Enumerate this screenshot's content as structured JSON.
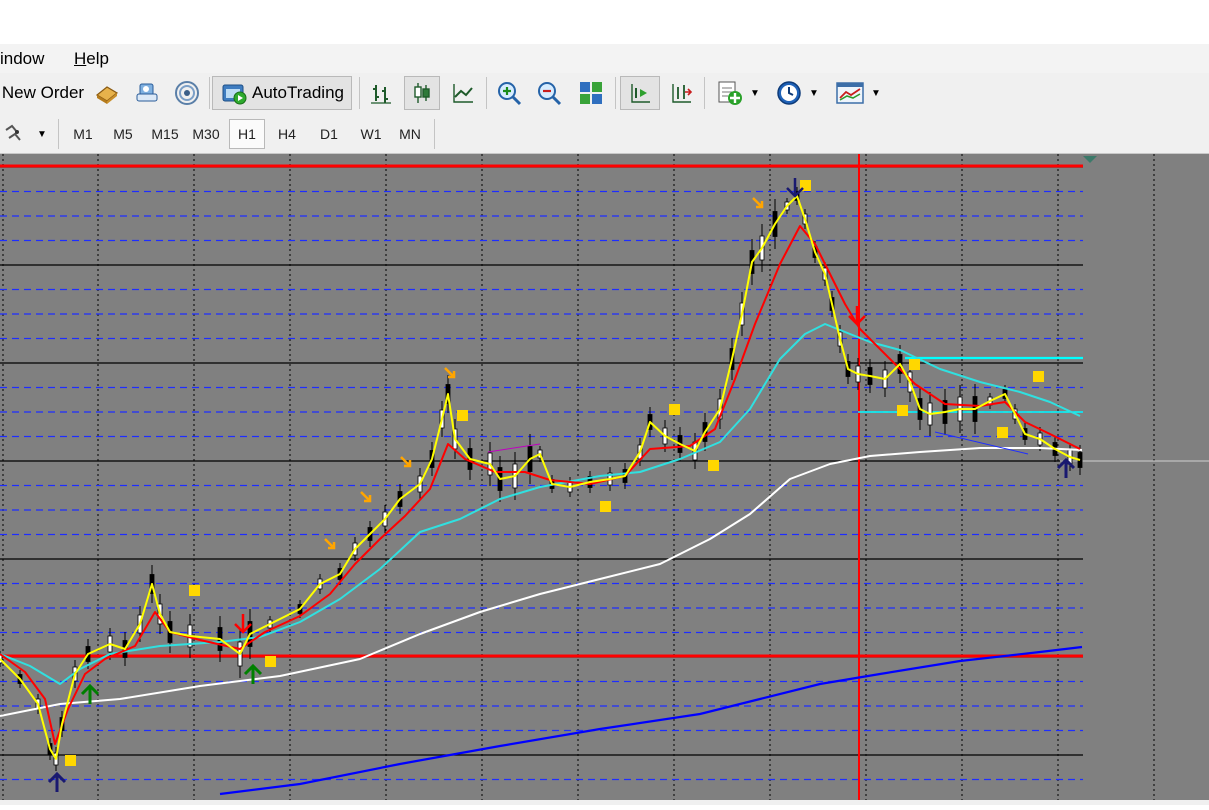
{
  "menu": {
    "window_label": "indow",
    "help_label": "Help"
  },
  "toolbar": {
    "new_order_label": "New Order",
    "autotrading_label": "AutoTrading",
    "icons": [
      "market-watch-icon",
      "data-window-icon",
      "signals-icon",
      "autotrading-icon",
      "bar-chart-icon",
      "candlestick-icon",
      "line-chart-icon",
      "zoom-in-icon",
      "zoom-out-icon",
      "tile-windows-icon",
      "chart-shift-icon",
      "autoscroll-icon",
      "indicators-icon",
      "periodicity-icon",
      "templates-icon"
    ]
  },
  "timeframes": {
    "items": [
      "M1",
      "M5",
      "M15",
      "M30",
      "H1",
      "H4",
      "D1",
      "W1",
      "MN"
    ],
    "active": "H1"
  },
  "chart_data": {
    "type": "line",
    "background": "#808080",
    "foreground": "#000000",
    "grid": true,
    "colors": {
      "price_fast": "#ffff00",
      "ma_red": "#ff0000",
      "ma_cyan": "#30e0e0",
      "ma_white": "#ffffff",
      "ma_blue": "#0000ff",
      "level_red": "#ff0000",
      "level_cyan": "#00ffff",
      "marker_square": "#ffd700",
      "arrow_down": "#ff0000",
      "arrow_up_green": "#008000",
      "arrow_up_navy": "#191970",
      "arrow_small": "#ffa500"
    }
  }
}
